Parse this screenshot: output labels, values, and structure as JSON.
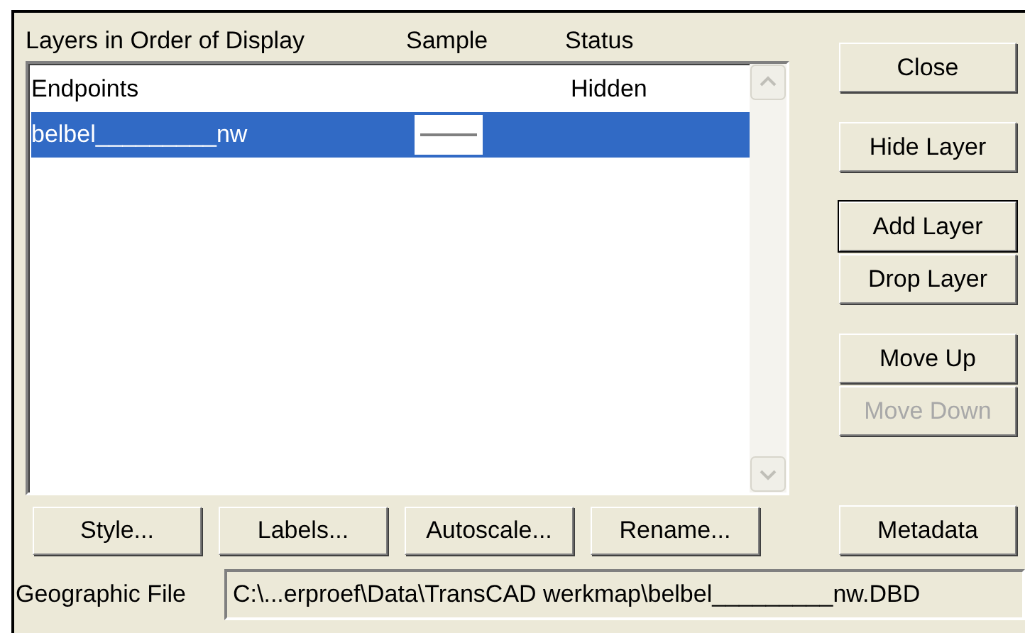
{
  "columns": [
    "Layers in Order of Display",
    "Sample",
    "Status"
  ],
  "layers": [
    {
      "name": "Endpoints",
      "sample": false,
      "status": "Hidden",
      "selected": false
    },
    {
      "name": "belbel_________nw",
      "sample": true,
      "selected": true
    }
  ],
  "side_button_groups": [
    [
      {
        "label": "Close",
        "disabled": false,
        "focused": false
      }
    ],
    [
      {
        "label": "Hide Layer",
        "disabled": false,
        "focused": false
      }
    ],
    [
      {
        "label": "Add Layer",
        "disabled": false,
        "focused": true
      },
      {
        "label": "Drop Layer",
        "disabled": false,
        "focused": false
      }
    ],
    [
      {
        "label": "Move Up",
        "disabled": false,
        "focused": false
      },
      {
        "label": "Move Down",
        "disabled": true,
        "focused": false
      }
    ],
    [
      {
        "label": "Metadata",
        "disabled": false,
        "focused": false
      }
    ]
  ],
  "bottom_buttons": [
    "Style...",
    "Labels...",
    "Autoscale...",
    "Rename..."
  ],
  "geographic_file": {
    "label": "Geographic File",
    "value": "C:\\...erproef\\Data\\TransCAD werkmap\\belbel_________nw.DBD"
  }
}
